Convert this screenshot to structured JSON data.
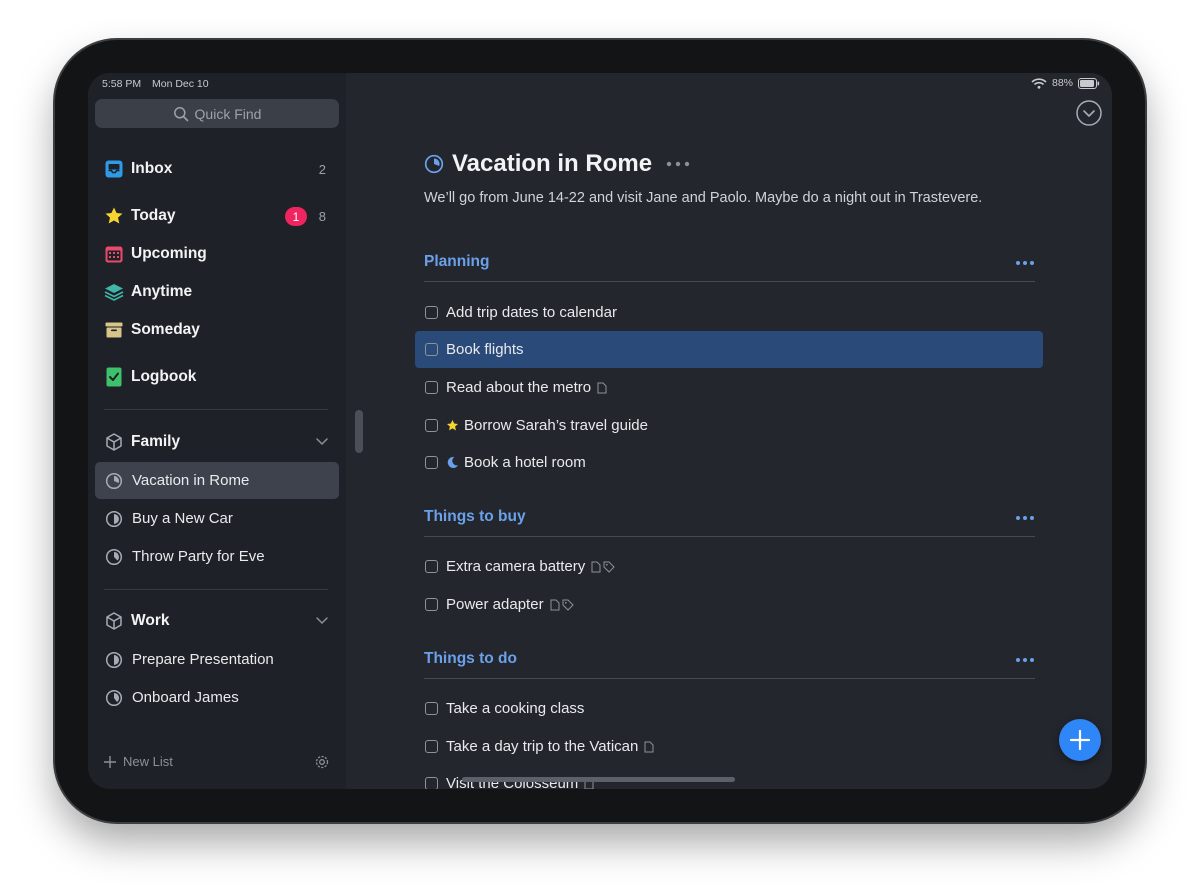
{
  "status": {
    "time": "5:58 PM",
    "date": "Mon Dec 10",
    "battery": "88%"
  },
  "sidebar": {
    "quick_find": "Quick Find",
    "inbox": {
      "label": "Inbox",
      "count": "2"
    },
    "today": {
      "label": "Today",
      "badge": "1",
      "count": "8"
    },
    "upcoming": {
      "label": "Upcoming"
    },
    "anytime": {
      "label": "Anytime"
    },
    "someday": {
      "label": "Someday"
    },
    "logbook": {
      "label": "Logbook"
    },
    "areas": [
      {
        "label": "Family",
        "projects": [
          "Vacation in Rome",
          "Buy a New Car",
          "Throw Party for Eve"
        ]
      },
      {
        "label": "Work",
        "projects": [
          "Prepare Presentation",
          "Onboard James"
        ]
      }
    ],
    "new_list": "New List"
  },
  "project": {
    "title": "Vacation in Rome",
    "notes": "We’ll go from June 14-22 and visit Jane and Paolo. Maybe do a night out in Trastevere.",
    "headings": [
      {
        "label": "Planning",
        "todos": [
          "Add trip dates to calendar",
          "Book flights",
          "Read about the metro",
          "Borrow Sarah’s travel guide",
          "Book a hotel room"
        ]
      },
      {
        "label": "Things to buy",
        "todos": [
          "Extra camera battery",
          "Power adapter"
        ]
      },
      {
        "label": "Things to do",
        "todos": [
          "Take a cooking class",
          "Take a day trip to the Vatican",
          "Visit the Colosseum"
        ]
      }
    ]
  },
  "colors": {
    "accent": "#6aa1ea",
    "selection": "#2a4a7a",
    "badge": "#f0245e",
    "fab": "#2f86f6"
  },
  "icons": [
    "search-icon",
    "inbox-icon",
    "star-icon",
    "calendar-icon",
    "layers-icon",
    "archive-box-icon",
    "logbook-icon",
    "cube-icon",
    "chevron-down-icon",
    "pie-progress-icon",
    "plus-icon",
    "gear-icon",
    "note-icon",
    "tag-icon",
    "moon-icon",
    "wifi-icon",
    "battery-icon",
    "ellipsis-icon"
  ]
}
